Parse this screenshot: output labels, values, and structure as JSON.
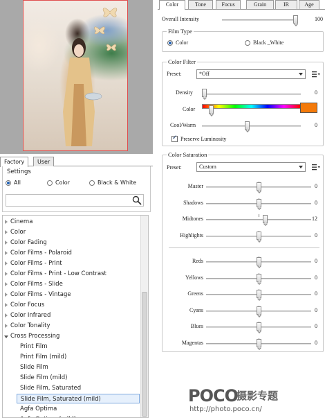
{
  "left_tabs": [
    "Factory",
    "User"
  ],
  "settings": {
    "title": "Settings",
    "radios": [
      {
        "label": "All",
        "selected": true
      },
      {
        "label": "Color",
        "selected": false
      },
      {
        "label": "Black & White",
        "selected": false
      }
    ],
    "search_value": "",
    "search_icon": "magnifier-icon"
  },
  "tree": [
    {
      "label": "Cinema",
      "level": 0,
      "expanded": false
    },
    {
      "label": "Color",
      "level": 0,
      "expanded": false
    },
    {
      "label": "Color Fading",
      "level": 0,
      "expanded": false
    },
    {
      "label": "Color Films - Polaroid",
      "level": 0,
      "expanded": false
    },
    {
      "label": "Color Films - Print",
      "level": 0,
      "expanded": false
    },
    {
      "label": "Color Films - Print - Low Contrast",
      "level": 0,
      "expanded": false
    },
    {
      "label": "Color Films - Slide",
      "level": 0,
      "expanded": false
    },
    {
      "label": "Color Films - Vintage",
      "level": 0,
      "expanded": false
    },
    {
      "label": "Color Focus",
      "level": 0,
      "expanded": false
    },
    {
      "label": "Color Infrared",
      "level": 0,
      "expanded": false
    },
    {
      "label": "Color Tonality",
      "level": 0,
      "expanded": false
    },
    {
      "label": "Cross Processing",
      "level": 0,
      "expanded": true
    },
    {
      "label": "Print Film",
      "level": 1
    },
    {
      "label": "Print Film (mild)",
      "level": 1
    },
    {
      "label": "Slide Film",
      "level": 1
    },
    {
      "label": "Slide Film (mild)",
      "level": 1
    },
    {
      "label": "Slide Film, Saturated",
      "level": 1
    },
    {
      "label": "Slide Film, Saturated (mild)",
      "level": 1,
      "selected": true
    },
    {
      "label": "Agfa Optima",
      "level": 1
    },
    {
      "label": "Agfa Optima (mild)",
      "level": 1
    }
  ],
  "right_tabs": [
    "Color",
    "Tone",
    "Focus",
    "Grain",
    "IR",
    "Age"
  ],
  "overall_intensity": {
    "label": "Overall Intensity",
    "value": 100
  },
  "film_type": {
    "title": "Film Type",
    "options": [
      {
        "label": "Color",
        "selected": true
      },
      {
        "label": "Black _White",
        "selected": false
      }
    ]
  },
  "color_filter": {
    "title": "Color Filter",
    "preset_label": "Preset:",
    "preset_value": "*Off",
    "density": {
      "label": "Density",
      "value": 0
    },
    "color": {
      "label": "Color",
      "swatch": "#f47a0a",
      "level": 0.05
    },
    "cool_warm": {
      "label": "Cool/Warm",
      "value": 0
    },
    "preserve_luminosity": {
      "label": "Preserve Luminosity",
      "checked": true
    }
  },
  "color_saturation": {
    "title": "Color Saturation",
    "preset_label": "Preset:",
    "preset_value": "Custom",
    "tone_sliders": [
      {
        "label": "Master",
        "value": 0
      },
      {
        "label": "Shadows",
        "value": 0
      },
      {
        "label": "Midtones",
        "value": 12
      },
      {
        "label": "Highlights",
        "value": 0
      }
    ],
    "color_sliders": [
      {
        "label": "Reds",
        "value": 0
      },
      {
        "label": "Yellows",
        "value": 0
      },
      {
        "label": "Greens",
        "value": 0
      },
      {
        "label": "Cyans",
        "value": 0
      },
      {
        "label": "Blues",
        "value": 0
      },
      {
        "label": "Magentas",
        "value": 0
      }
    ]
  },
  "menu_icon": "list-menu-icon",
  "watermark": {
    "logo": "POCO",
    "title": "摄影专题",
    "url": "http://photo.poco.cn/"
  }
}
